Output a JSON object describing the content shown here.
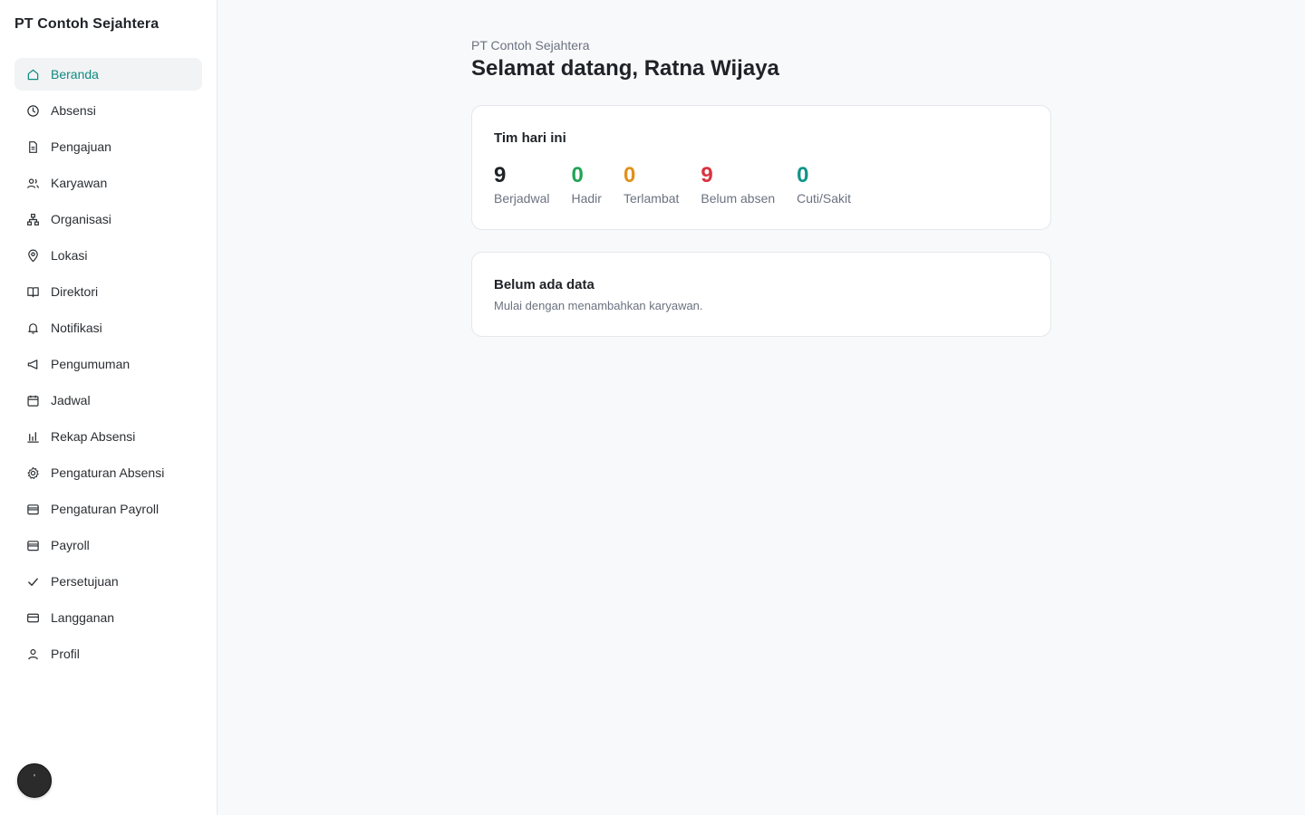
{
  "sidebar": {
    "brand": "PT Contoh Sejahtera",
    "items": [
      {
        "label": "Beranda",
        "icon": "home-icon",
        "active": true
      },
      {
        "label": "Absensi",
        "icon": "clock-icon"
      },
      {
        "label": "Pengajuan",
        "icon": "document-icon"
      },
      {
        "label": "Karyawan",
        "icon": "users-icon"
      },
      {
        "label": "Organisasi",
        "icon": "org-chart-icon"
      },
      {
        "label": "Lokasi",
        "icon": "map-pin-icon"
      },
      {
        "label": "Direktori",
        "icon": "book-icon"
      },
      {
        "label": "Notifikasi",
        "icon": "bell-icon"
      },
      {
        "label": "Pengumuman",
        "icon": "megaphone-icon"
      },
      {
        "label": "Jadwal",
        "icon": "calendar-icon"
      },
      {
        "label": "Rekap Absensi",
        "icon": "bar-chart-icon"
      },
      {
        "label": "Pengaturan Absensi",
        "icon": "gear-icon"
      },
      {
        "label": "Pengaturan Payroll",
        "icon": "wallet-icon"
      },
      {
        "label": "Payroll",
        "icon": "wallet-icon"
      },
      {
        "label": "Persetujuan",
        "icon": "check-icon"
      },
      {
        "label": "Langganan",
        "icon": "credit-card-icon"
      },
      {
        "label": "Profil",
        "icon": "user-icon"
      }
    ],
    "fab_label": "'"
  },
  "header": {
    "org": "PT Contoh Sejahtera",
    "welcome": "Selamat datang, Ratna Wijaya"
  },
  "team": {
    "title": "Tim hari ini",
    "stats": [
      {
        "value": "9",
        "label": "Berjadwal",
        "color": "#1f2328"
      },
      {
        "value": "0",
        "label": "Hadir",
        "color": "#22a356"
      },
      {
        "value": "0",
        "label": "Terlambat",
        "color": "#e0911a"
      },
      {
        "value": "9",
        "label": "Belum absen",
        "color": "#d8343f"
      },
      {
        "value": "0",
        "label": "Cuti/Sakit",
        "color": "#0f9488"
      }
    ]
  },
  "empty": {
    "title": "Belum ada data",
    "subtitle": "Mulai dengan menambahkan karyawan."
  },
  "colors": {
    "accent": "#0f8a80",
    "active_bg": "#f1f3f4"
  }
}
